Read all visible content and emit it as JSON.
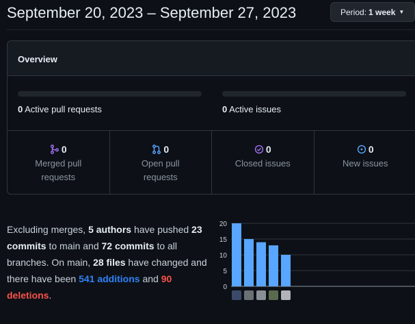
{
  "header": {
    "date_range": "September 20, 2023 – September 27, 2023",
    "period_label": "Period:",
    "period_value": "1 week"
  },
  "overview": {
    "title": "Overview",
    "active_pull_requests": {
      "count": "0",
      "label": "Active pull requests"
    },
    "active_issues": {
      "count": "0",
      "label": "Active issues"
    },
    "cells": [
      {
        "count": "0",
        "label": "Merged pull requests",
        "icon": "git-merge-icon",
        "color": "#a371f7"
      },
      {
        "count": "0",
        "label": "Open pull requests",
        "icon": "git-pull-request-icon",
        "color": "#3fb950"
      },
      {
        "count": "0",
        "label": "Closed issues",
        "icon": "issue-closed-icon",
        "color": "#a371f7"
      },
      {
        "count": "0",
        "label": "New issues",
        "icon": "issue-opened-icon",
        "color": "#3fb950"
      }
    ]
  },
  "summary": {
    "t1": "Excluding merges, ",
    "authors": "5 authors",
    "t2": " have pushed ",
    "commits_main": "23 commits",
    "t3": " to main and ",
    "commits_all": "72 commits",
    "t4": " to all branches. On main, ",
    "files": "28 files",
    "t5": " have changed and there have been ",
    "additions": "541 additions",
    "t6": " and ",
    "deletions": "90 deletions",
    "t7": "."
  },
  "chart_data": {
    "type": "bar",
    "categories": [
      "author-1",
      "author-2",
      "author-3",
      "author-4",
      "author-5"
    ],
    "values": [
      20,
      15,
      14,
      13,
      10
    ],
    "ylim": [
      0,
      20
    ],
    "yticks": [
      "0",
      "5",
      "10",
      "15",
      "20"
    ],
    "bar_color": "#58a6ff",
    "grid": true,
    "xlabel": "",
    "ylabel": ""
  }
}
